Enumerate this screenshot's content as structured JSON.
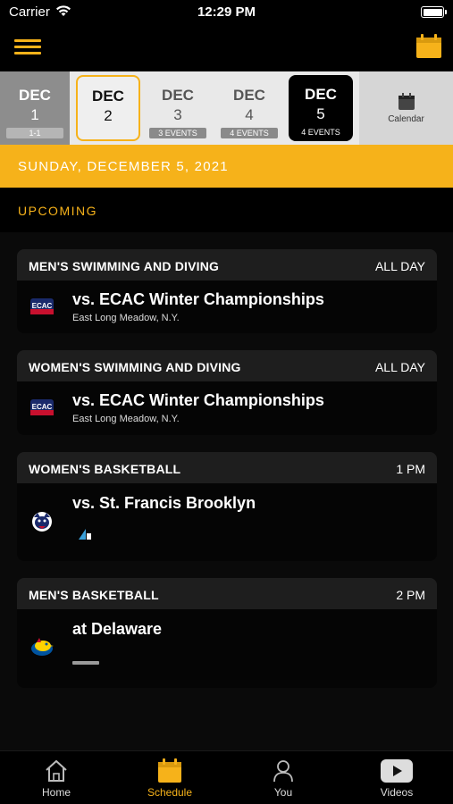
{
  "status": {
    "carrier": "Carrier",
    "time": "12:29 PM"
  },
  "dates": [
    {
      "month": "DEC",
      "day": "1",
      "badge": "1-1",
      "state": "past"
    },
    {
      "month": "DEC",
      "day": "2",
      "badge": "",
      "state": "selected"
    },
    {
      "month": "DEC",
      "day": "3",
      "badge": "3 EVENTS",
      "state": "normal"
    },
    {
      "month": "DEC",
      "day": "4",
      "badge": "4 EVENTS",
      "state": "normal"
    },
    {
      "month": "DEC",
      "day": "5",
      "badge": "4 EVENTS",
      "state": "active"
    }
  ],
  "calendar_label": "Calendar",
  "day_banner": "SUNDAY, DECEMBER 5, 2021",
  "section_label": "UPCOMING",
  "events": [
    {
      "sport": "MEN'S SWIMMING AND DIVING",
      "time": "ALL DAY",
      "opponent": "vs. ECAC Winter Championships",
      "location": "East Long Meadow, N.Y.",
      "logo": "ecac-logo"
    },
    {
      "sport": "WOMEN'S SWIMMING AND DIVING",
      "time": "ALL DAY",
      "opponent": "vs. ECAC Winter Championships",
      "location": "East Long Meadow, N.Y.",
      "logo": "ecac-logo"
    },
    {
      "sport": "WOMEN'S BASKETBALL",
      "time": "1 PM",
      "opponent": "vs. St. Francis Brooklyn",
      "location": "",
      "logo": "st-francis-terrier-logo"
    },
    {
      "sport": "MEN'S BASKETBALL",
      "time": "2 PM",
      "opponent": "at Delaware",
      "location": "",
      "logo": "delaware-blue-hen-logo"
    }
  ],
  "tabs": [
    {
      "label": "Home",
      "icon": "home-icon",
      "active": false
    },
    {
      "label": "Schedule",
      "icon": "calendar-icon",
      "active": true
    },
    {
      "label": "You",
      "icon": "user-icon",
      "active": false
    },
    {
      "label": "Videos",
      "icon": "play-icon",
      "active": false
    }
  ],
  "colors": {
    "accent": "#f6b21a",
    "background": "#0a0a0a",
    "card": "#141414"
  }
}
